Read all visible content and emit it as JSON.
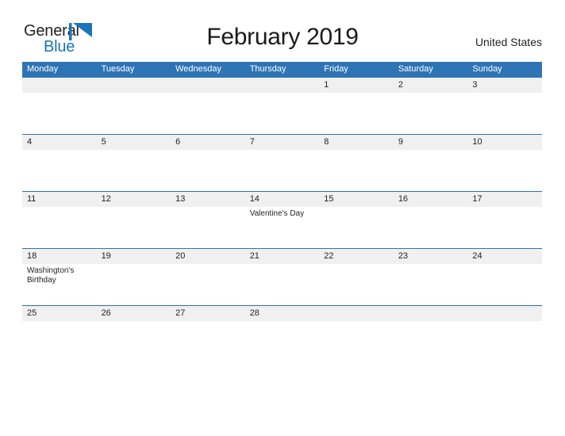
{
  "brand": {
    "word_one": "General",
    "word_two": "Blue",
    "mark_icon": "triangle-flag-icon",
    "color_dark": "#231f20",
    "color_blue": "#1b75bb"
  },
  "header": {
    "title": "February 2019",
    "region": "United States"
  },
  "calendar": {
    "header_bg": "#2e74b5",
    "day_band_bg": "#f0f0f0",
    "weekday_headers": [
      "Monday",
      "Tuesday",
      "Wednesday",
      "Thursday",
      "Friday",
      "Saturday",
      "Sunday"
    ],
    "weeks": [
      [
        {
          "date": "",
          "event": ""
        },
        {
          "date": "",
          "event": ""
        },
        {
          "date": "",
          "event": ""
        },
        {
          "date": "",
          "event": ""
        },
        {
          "date": "1",
          "event": ""
        },
        {
          "date": "2",
          "event": ""
        },
        {
          "date": "3",
          "event": ""
        }
      ],
      [
        {
          "date": "4",
          "event": ""
        },
        {
          "date": "5",
          "event": ""
        },
        {
          "date": "6",
          "event": ""
        },
        {
          "date": "7",
          "event": ""
        },
        {
          "date": "8",
          "event": ""
        },
        {
          "date": "9",
          "event": ""
        },
        {
          "date": "10",
          "event": ""
        }
      ],
      [
        {
          "date": "11",
          "event": ""
        },
        {
          "date": "12",
          "event": ""
        },
        {
          "date": "13",
          "event": ""
        },
        {
          "date": "14",
          "event": "Valentine's Day"
        },
        {
          "date": "15",
          "event": ""
        },
        {
          "date": "16",
          "event": ""
        },
        {
          "date": "17",
          "event": ""
        }
      ],
      [
        {
          "date": "18",
          "event": "Washington's Birthday"
        },
        {
          "date": "19",
          "event": ""
        },
        {
          "date": "20",
          "event": ""
        },
        {
          "date": "21",
          "event": ""
        },
        {
          "date": "22",
          "event": ""
        },
        {
          "date": "23",
          "event": ""
        },
        {
          "date": "24",
          "event": ""
        }
      ],
      [
        {
          "date": "25",
          "event": ""
        },
        {
          "date": "26",
          "event": ""
        },
        {
          "date": "27",
          "event": ""
        },
        {
          "date": "28",
          "event": ""
        },
        {
          "date": "",
          "event": ""
        },
        {
          "date": "",
          "event": ""
        },
        {
          "date": "",
          "event": ""
        }
      ]
    ]
  }
}
